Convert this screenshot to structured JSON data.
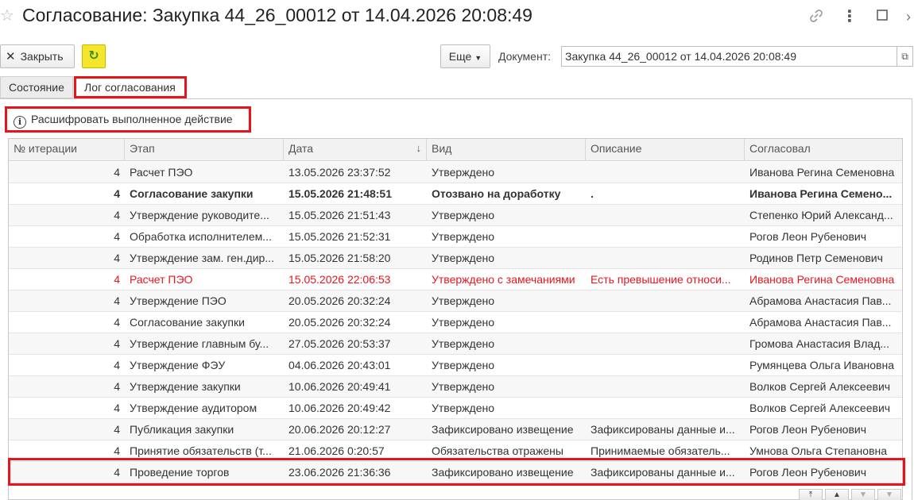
{
  "window": {
    "title": "Согласование: Закупка 44_26_00012 от 14.04.2026 20:08:49"
  },
  "toolbar": {
    "close_label": "Закрыть",
    "more_label": "Еще",
    "document_label": "Документ:",
    "document_value": "Закупка 44_26_00012 от 14.04.2026 20:08:49"
  },
  "tabs": [
    {
      "label": "Состояние"
    },
    {
      "label": "Лог согласования"
    }
  ],
  "decode_button": {
    "label": "Расшифровать выполненное действие"
  },
  "table": {
    "columns": [
      "№ итерации",
      "Этап",
      "Дата",
      "Вид",
      "Описание",
      "Согласовал"
    ],
    "rows": [
      {
        "iter": "4",
        "stage": "Расчет ПЭО",
        "date": "13.05.2026 23:37:52",
        "kind": "Утверждено",
        "desc": "",
        "approver": "Иванова Регина Семеновна",
        "style": ""
      },
      {
        "iter": "4",
        "stage": "Согласование закупки",
        "date": "15.05.2026 21:48:51",
        "kind": "Отозвано на доработку",
        "desc": ".",
        "approver": "Иванова Регина Семено...",
        "style": "bold"
      },
      {
        "iter": "4",
        "stage": "Утверждение руководите...",
        "date": "15.05.2026 21:51:43",
        "kind": "Утверждено",
        "desc": "",
        "approver": "Степенко Юрий Александ...",
        "style": ""
      },
      {
        "iter": "4",
        "stage": "Обработка исполнителем...",
        "date": "15.05.2026 21:52:31",
        "kind": "Утверждено",
        "desc": "",
        "approver": "Рогов Леон Рубенович",
        "style": ""
      },
      {
        "iter": "4",
        "stage": "Утверждение зам. ген.дир...",
        "date": "15.05.2026 21:58:20",
        "kind": "Утверждено",
        "desc": "",
        "approver": "Родинов Петр Семенович",
        "style": ""
      },
      {
        "iter": "4",
        "stage": "Расчет ПЭО",
        "date": "15.05.2026 22:06:53",
        "kind": "Утверждено с замечаниями",
        "desc": "Есть превышение относи...",
        "approver": "Иванова Регина Семеновна",
        "style": "red"
      },
      {
        "iter": "4",
        "stage": "Утверждение ПЭО",
        "date": "20.05.2026 20:32:24",
        "kind": "Утверждено",
        "desc": "",
        "approver": "Абрамова Анастасия Пав...",
        "style": ""
      },
      {
        "iter": "4",
        "stage": "Согласование закупки",
        "date": "20.05.2026 20:32:24",
        "kind": "Утверждено",
        "desc": "",
        "approver": "Абрамова Анастасия Пав...",
        "style": ""
      },
      {
        "iter": "4",
        "stage": "Утверждение главным бу...",
        "date": "27.05.2026 20:53:37",
        "kind": "Утверждено",
        "desc": "",
        "approver": "Громова Анастасия Влад...",
        "style": ""
      },
      {
        "iter": "4",
        "stage": "Утверждение ФЭУ",
        "date": "04.06.2026 20:43:01",
        "kind": "Утверждено",
        "desc": "",
        "approver": "Румянцева Ольга Ивановна",
        "style": ""
      },
      {
        "iter": "4",
        "stage": "Утверждение закупки",
        "date": "10.06.2026 20:49:41",
        "kind": "Утверждено",
        "desc": "",
        "approver": "Волков Сергей Алексеевич",
        "style": ""
      },
      {
        "iter": "4",
        "stage": "Утверждение аудитором",
        "date": "10.06.2026 20:49:42",
        "kind": "Утверждено",
        "desc": "",
        "approver": "Волков Сергей Алексеевич",
        "style": ""
      },
      {
        "iter": "4",
        "stage": "Публикация закупки",
        "date": "20.06.2026 20:12:27",
        "kind": "Зафиксировано извещение",
        "desc": "Зафиксированы данные и...",
        "approver": "Рогов Леон Рубенович",
        "style": ""
      },
      {
        "iter": "4",
        "stage": "Принятие обязательств (т...",
        "date": "21.06.2026 0:20:57",
        "kind": "Обязательства отражены",
        "desc": "Принимаемые обязатель...",
        "approver": "Умнова Ольга Степановна",
        "style": ""
      },
      {
        "iter": "4",
        "stage": "Проведение торгов",
        "date": "23.06.2026 21:36:36",
        "kind": "Зафиксировано извещение",
        "desc": "Зафиксированы данные и...",
        "approver": "Рогов Леон Рубенович",
        "style": ""
      }
    ]
  },
  "colors": {
    "highlight": "#e8141c",
    "refresh_button": "#f5e52c",
    "rejected_row_text": "#e8141c"
  }
}
